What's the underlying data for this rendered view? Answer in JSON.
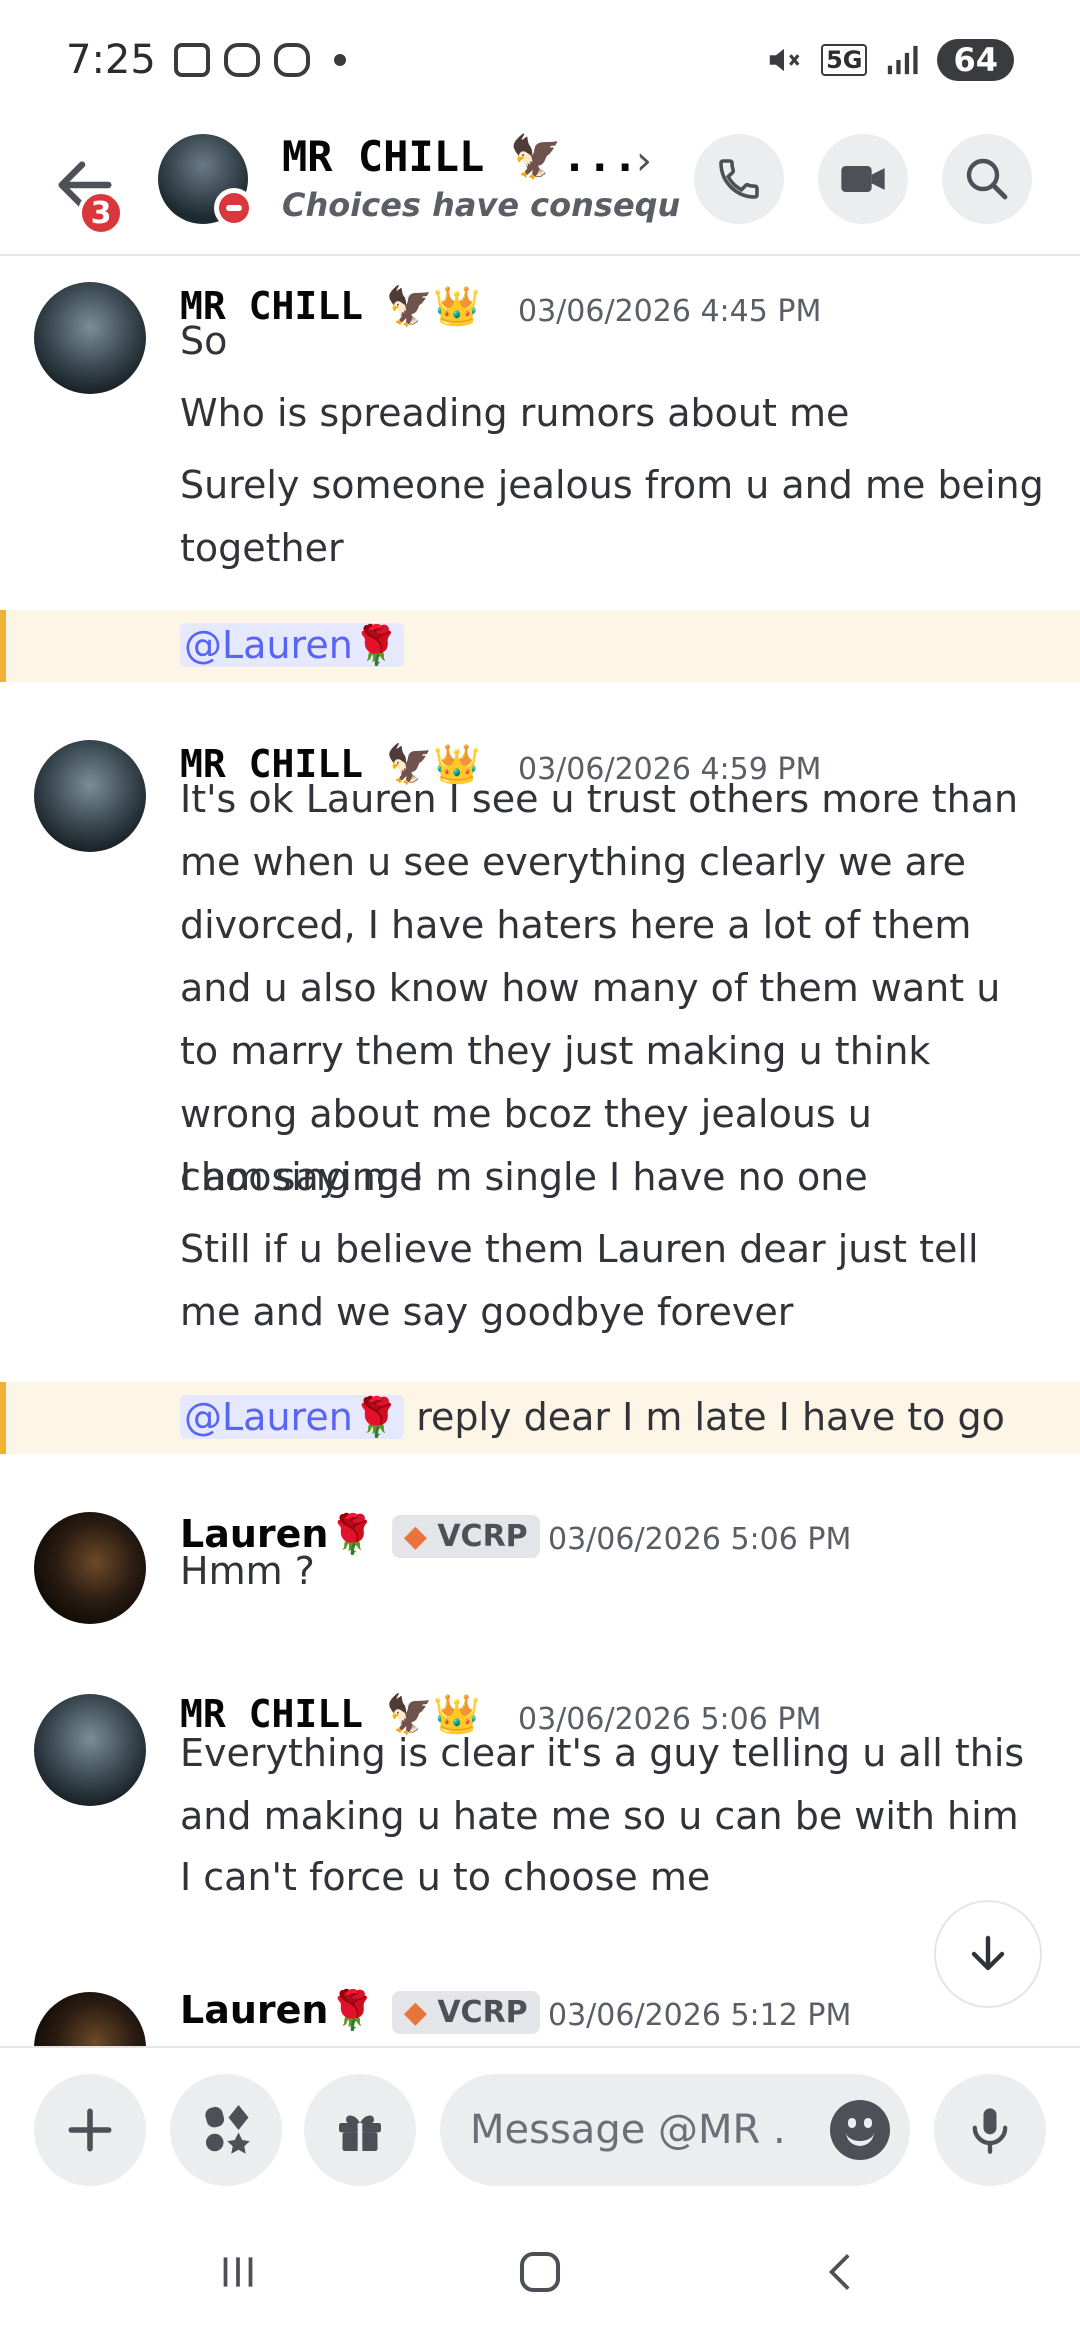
{
  "status_bar": {
    "time": "7:25",
    "network": "5G",
    "battery": "64"
  },
  "header": {
    "back_badge": "3",
    "name": "MR CHILL 🦅...",
    "subtitle": "Choices have consequ..."
  },
  "messages": [
    {
      "author": "MR CHILL",
      "author_emoji": "🦅👑",
      "timestamp": "03/06/2026 4:45 PM",
      "lines": [
        "So",
        "Who is spreading rumors about me",
        "Surely someone jealous from u and me being together"
      ],
      "mention": "@Lauren🌹",
      "mention_text": ""
    },
    {
      "author": "MR CHILL",
      "author_emoji": "🦅👑",
      "timestamp": "03/06/2026 4:59 PM",
      "lines": [
        "It's ok Lauren I see u trust others more than me when u see everything clearly we are divorced, I have haters here a lot of them and u also know how many of them want u to marry them they just making u think wrong about me bcoz they jealous u choosing me",
        "I am saying I m single I have no one",
        "Still if u believe them Lauren dear  just tell me and we say goodbye forever"
      ],
      "mention": "@Lauren🌹",
      "mention_text": " reply dear I m late I have to go"
    },
    {
      "author": "Lauren",
      "author_emoji": "🌹",
      "tag": "VCRP",
      "timestamp": "03/06/2026 5:06 PM",
      "lines": [
        "Hmm ?"
      ]
    },
    {
      "author": "MR CHILL",
      "author_emoji": "🦅👑",
      "timestamp": "03/06/2026 5:06 PM",
      "lines": [
        "Everything is clear it's a guy telling u all this and making u hate me so u can be with him",
        "I can't force u to choose me"
      ]
    },
    {
      "author": "Lauren",
      "author_emoji": "🌹",
      "tag": "VCRP",
      "timestamp": "03/06/2026 5:12 PM",
      "lines": []
    }
  ],
  "composer": {
    "placeholder": "Message @MR ..."
  },
  "icons": {
    "back": "arrow-left-icon",
    "call": "phone-icon",
    "video": "video-camera-icon",
    "search": "search-icon",
    "add": "plus-icon",
    "apps": "apps-icon",
    "gift": "gift-icon",
    "emoji": "emoji-icon",
    "mic": "microphone-icon",
    "scroll": "arrow-down-icon"
  },
  "colors": {
    "mention_bg": "#fdf5e6",
    "mention_bar": "#f0b232",
    "mention_text": "#5865f2",
    "dnd": "#da373c"
  }
}
